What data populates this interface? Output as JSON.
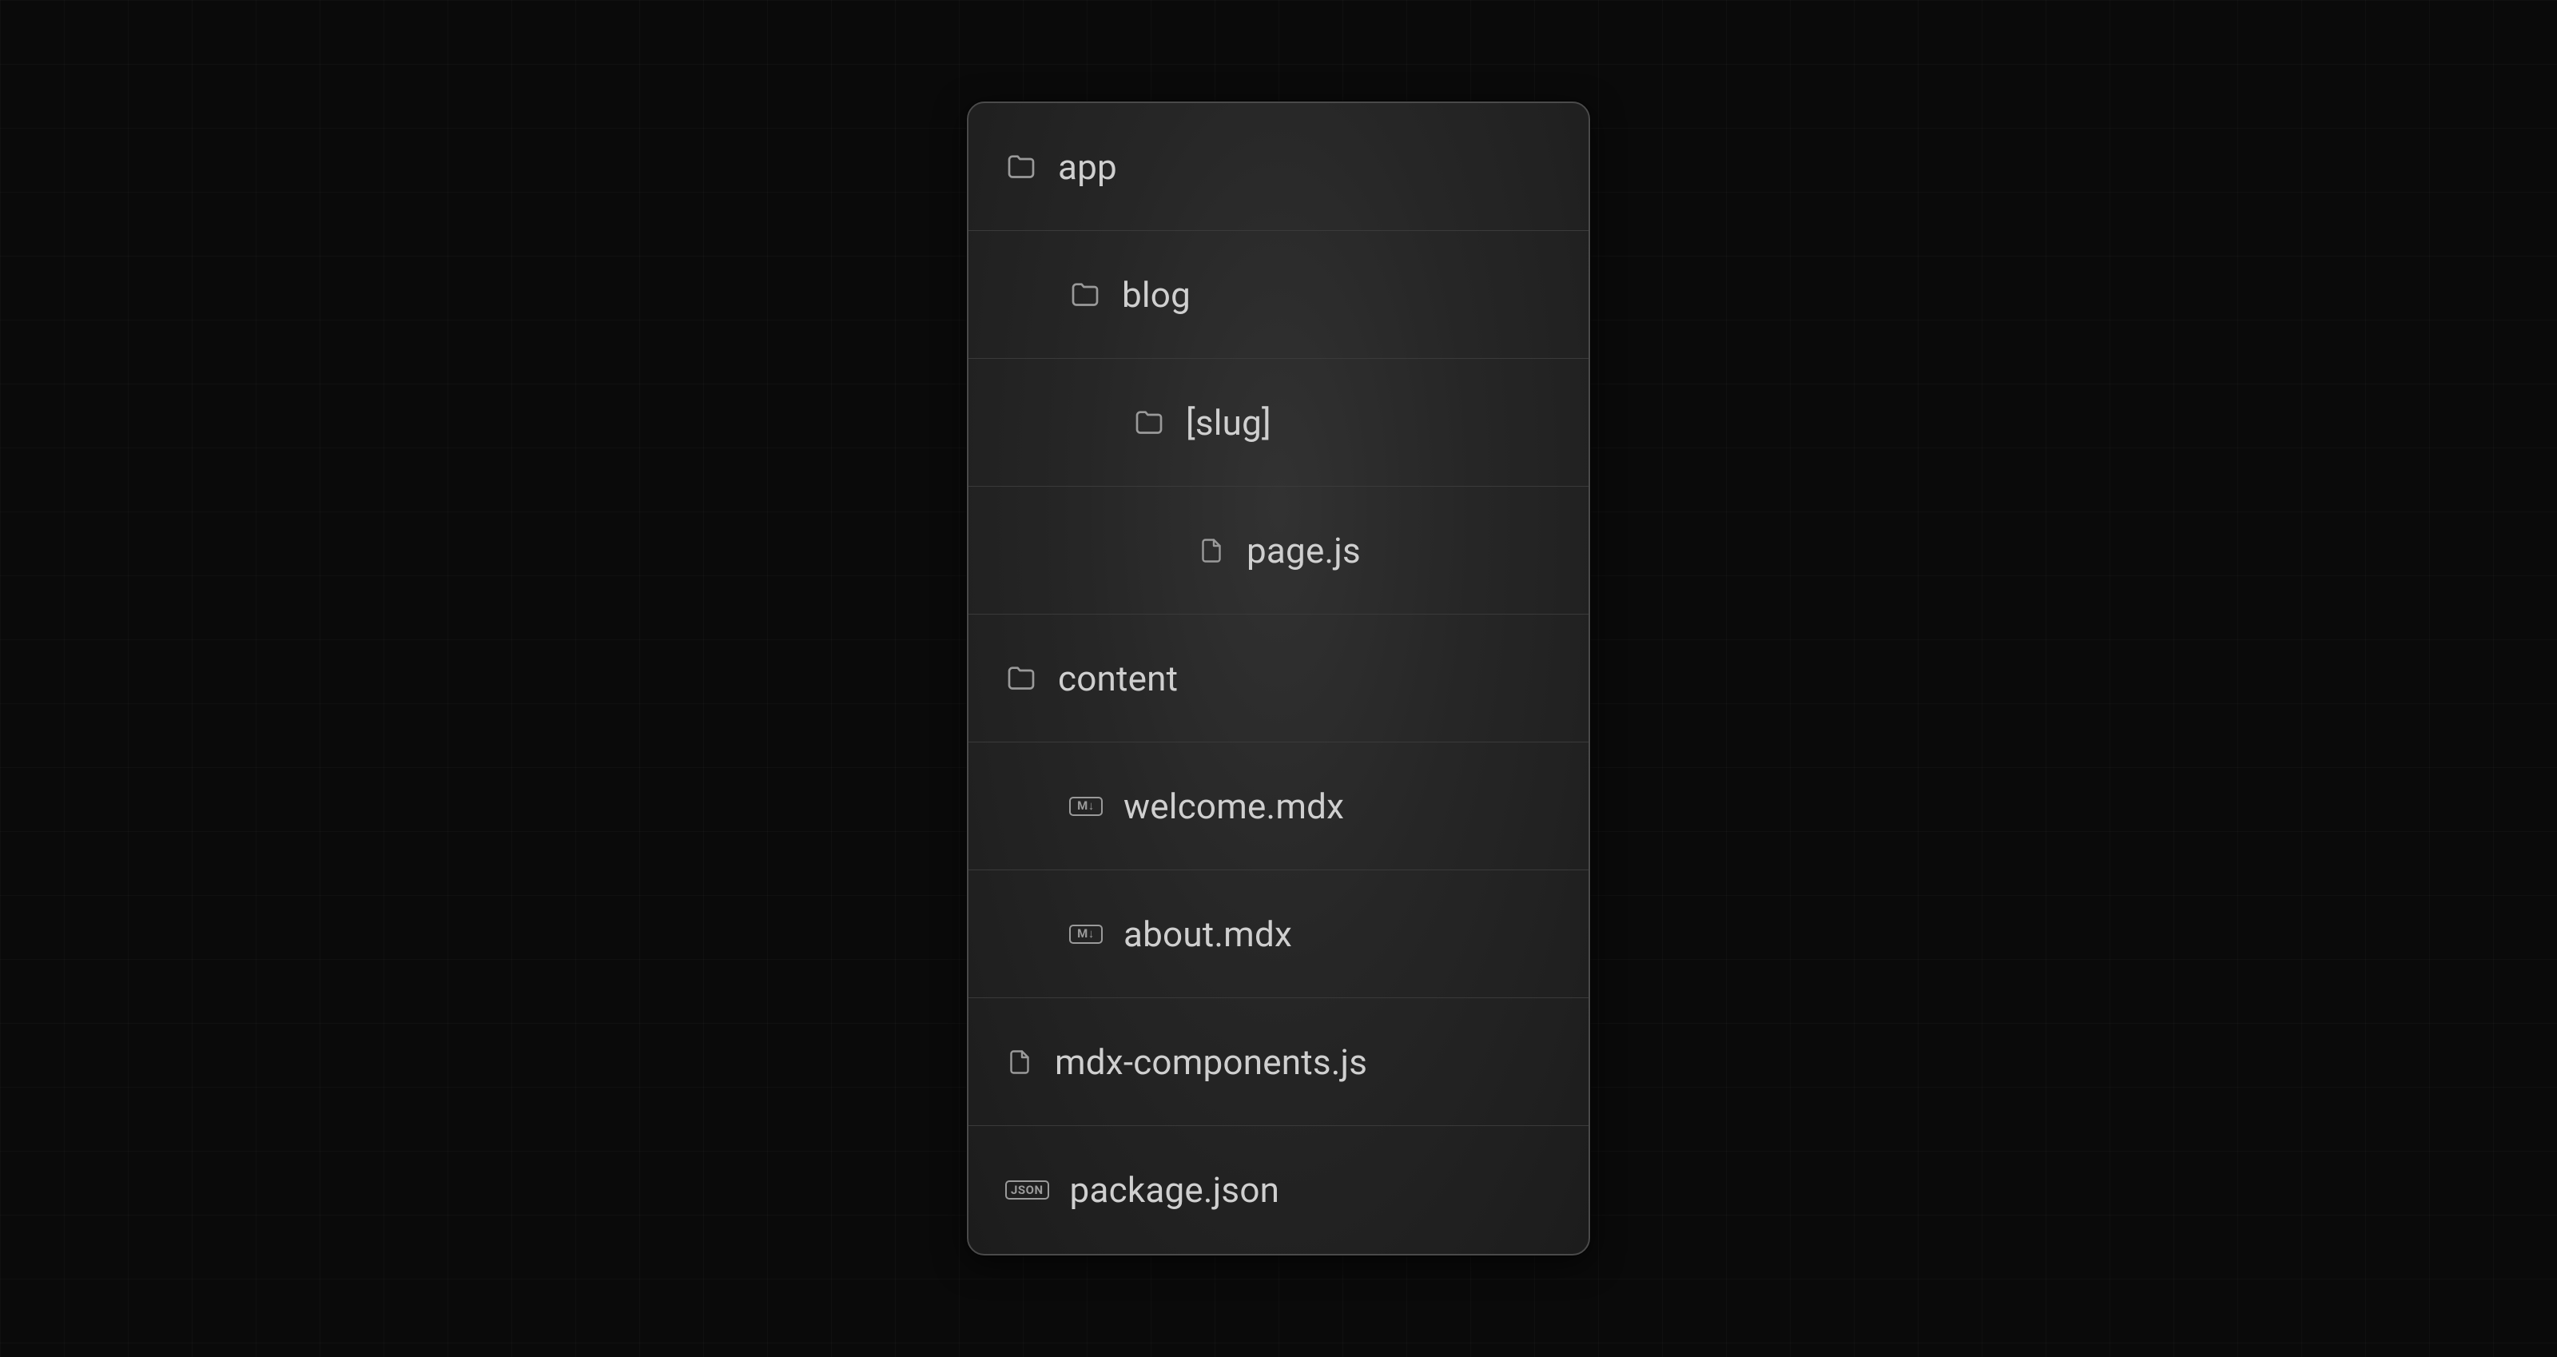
{
  "icons": {
    "md_badge": "M↓",
    "json_badge": "JSON"
  },
  "tree": {
    "rows": [
      {
        "type": "folder",
        "depth": 0,
        "label": "app"
      },
      {
        "type": "folder",
        "depth": 1,
        "label": "blog"
      },
      {
        "type": "folder",
        "depth": 2,
        "label": "[slug]"
      },
      {
        "type": "file",
        "depth": 3,
        "label": "page.js",
        "icon": "file"
      },
      {
        "type": "folder",
        "depth": 0,
        "label": "content"
      },
      {
        "type": "file",
        "depth": 1,
        "label": "welcome.mdx",
        "icon": "md"
      },
      {
        "type": "file",
        "depth": 1,
        "label": "about.mdx",
        "icon": "md"
      },
      {
        "type": "file",
        "depth": 0,
        "label": "mdx-components.js",
        "icon": "file"
      },
      {
        "type": "file",
        "depth": 0,
        "label": "package.json",
        "icon": "json"
      }
    ]
  }
}
